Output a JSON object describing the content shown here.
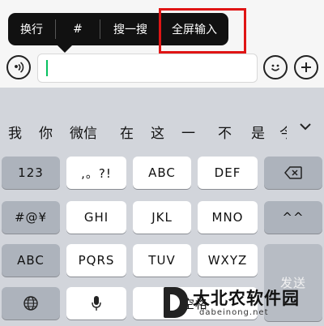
{
  "context_menu": {
    "items": [
      "换行",
      "#",
      "搜一搜",
      "全屏输入"
    ]
  },
  "input_bar": {
    "voice_icon": "voice-icon",
    "emoji_icon": "emoji-icon",
    "plus_icon": "plus-icon",
    "value": ""
  },
  "suggestions": {
    "items": [
      "我",
      "你",
      "微信",
      "在",
      "这",
      "一",
      "不",
      "是",
      "今"
    ],
    "expand_icon": "chevron-down-icon"
  },
  "keyboard": {
    "row1": [
      "123",
      ",。?!",
      "ABC",
      "DEF"
    ],
    "row2": [
      "#@¥",
      "GHI",
      "JKL",
      "MNO",
      "^^"
    ],
    "row3": [
      "ABC",
      "PQRS",
      "TUV",
      "WXYZ"
    ],
    "row4": {
      "globe_icon": "globe-icon",
      "mic_icon": "microphone-icon",
      "space": "空格"
    },
    "backspace_icon": "backspace-icon",
    "send": "发送"
  },
  "watermark": {
    "title": "大北农软件园",
    "url": "dabeinong.net"
  },
  "colors": {
    "highlight": "#e01515",
    "caret": "#07c160"
  }
}
